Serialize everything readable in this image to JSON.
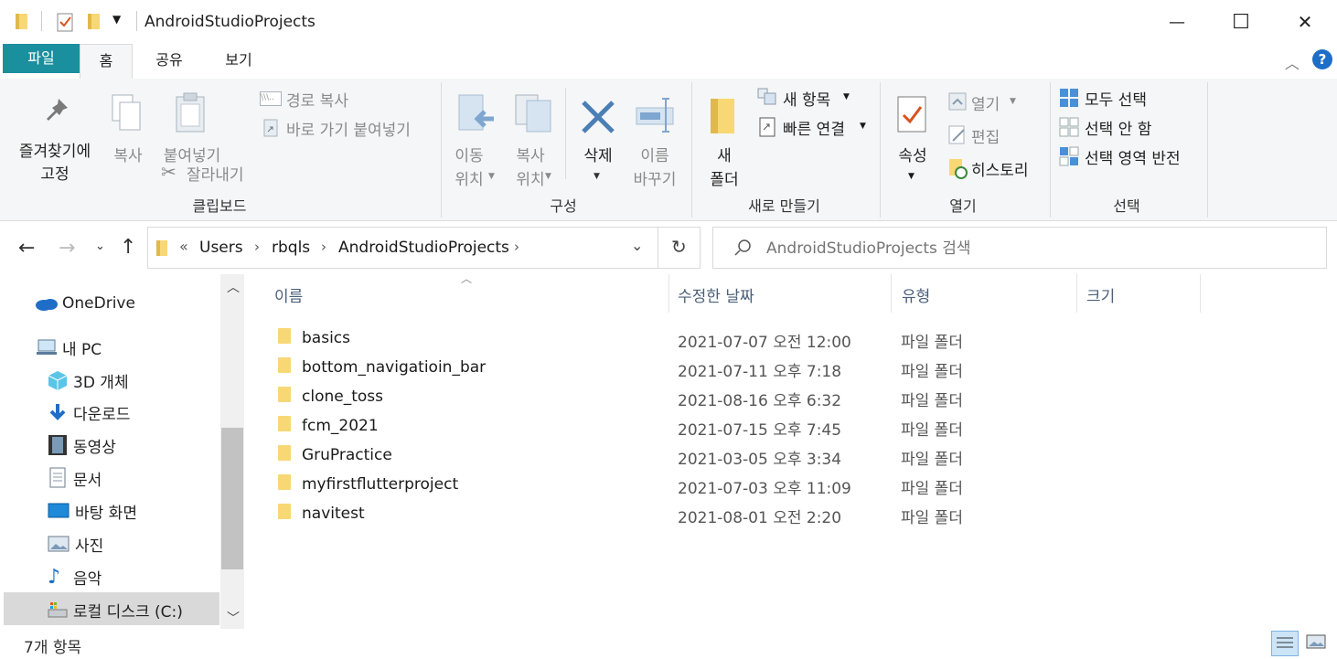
{
  "window": {
    "title": "AndroidStudioProjects",
    "controls": {
      "minimize": "—",
      "maximize": "☐",
      "close": "✕"
    }
  },
  "ribbon_tabs": [
    "파일",
    "홈",
    "공유",
    "보기"
  ],
  "ribbon": {
    "clipboard": {
      "pin_label": "즐겨찾기에\n고정",
      "copy_label": "복사",
      "paste_label": "붙여넣기",
      "copy_path": "경로 복사",
      "paste_shortcut": "바로 가기 붙여넣기",
      "cut": "잘라내기",
      "group": "클립보드"
    },
    "organize": {
      "move_to_1": "이동",
      "move_to_2": "위치",
      "copy_to_1": "복사",
      "copy_to_2": "위치",
      "delete": "삭제",
      "rename_1": "이름",
      "rename_2": "바꾸기",
      "group": "구성"
    },
    "new": {
      "new_folder_1": "새",
      "new_folder_2": "폴더",
      "new_item": "새 항목",
      "easy_access": "빠른 연결",
      "group": "새로 만들기"
    },
    "open": {
      "properties": "속성",
      "open": "열기",
      "edit": "편집",
      "history": "히스토리",
      "group": "열기"
    },
    "select": {
      "select_all": "모두 선택",
      "select_none": "선택 안 함",
      "invert": "선택 영역 반전",
      "group": "선택"
    }
  },
  "address": {
    "breadcrumb": [
      "Users",
      "rbqls",
      "AndroidStudioProjects"
    ],
    "overflow": "«",
    "search_placeholder": "AndroidStudioProjects 검색"
  },
  "nav": {
    "items": [
      {
        "label": "OneDrive",
        "icon": "onedrive-icon"
      },
      {
        "label": "내 PC",
        "icon": "pc-icon"
      },
      {
        "label": "3D 개체",
        "icon": "cube-icon"
      },
      {
        "label": "다운로드",
        "icon": "download-icon"
      },
      {
        "label": "동영상",
        "icon": "video-icon"
      },
      {
        "label": "문서",
        "icon": "document-icon"
      },
      {
        "label": "바탕 화면",
        "icon": "desktop-icon"
      },
      {
        "label": "사진",
        "icon": "picture-icon"
      },
      {
        "label": "음악",
        "icon": "music-icon"
      },
      {
        "label": "로컬 디스크 (C:)",
        "icon": "drive-icon"
      }
    ]
  },
  "columns": [
    "이름",
    "수정한 날짜",
    "유형",
    "크기"
  ],
  "files": [
    {
      "name": "basics",
      "modified": "2021-07-07 오전 12:00",
      "type": "파일 폴더"
    },
    {
      "name": "bottom_navigatioin_bar",
      "modified": "2021-07-11 오후 7:18",
      "type": "파일 폴더"
    },
    {
      "name": "clone_toss",
      "modified": "2021-08-16 오후 6:32",
      "type": "파일 폴더"
    },
    {
      "name": "fcm_2021",
      "modified": "2021-07-15 오후 7:45",
      "type": "파일 폴더"
    },
    {
      "name": "GruPractice",
      "modified": "2021-03-05 오후 3:34",
      "type": "파일 폴더"
    },
    {
      "name": "myfirstflutterproject",
      "modified": "2021-07-03 오후 11:09",
      "type": "파일 폴더"
    },
    {
      "name": "navitest",
      "modified": "2021-08-01 오전 2:20",
      "type": "파일 폴더"
    }
  ],
  "status": {
    "count": "7개 항목"
  },
  "colors": {
    "accent": "#1a8f9e",
    "folder": "#f8d775",
    "ribbon_bg": "#f5f6f7",
    "header_text": "#4c607a"
  }
}
